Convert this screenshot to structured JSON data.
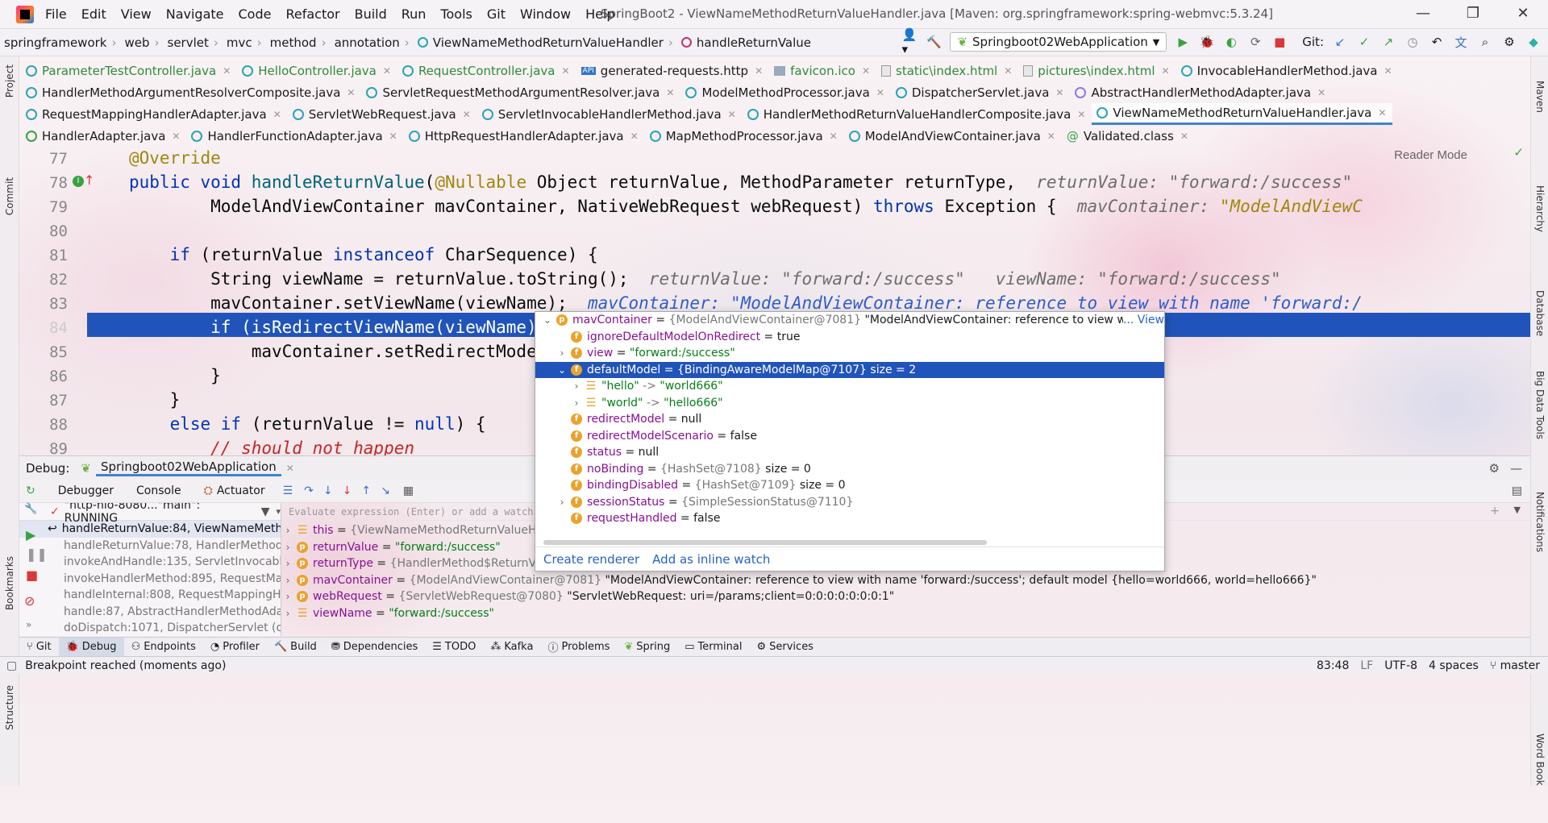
{
  "window": {
    "title": "SpringBoot2 - ViewNameMethodReturnValueHandler.java [Maven: org.springframework:spring-webmvc:5.3.24]",
    "menu": [
      "File",
      "Edit",
      "View",
      "Navigate",
      "Code",
      "Refactor",
      "Build",
      "Run",
      "Tools",
      "Git",
      "Window",
      "Help"
    ]
  },
  "breadcrumb": [
    "springframework",
    "web",
    "servlet",
    "mvc",
    "method",
    "annotation",
    "ViewNameMethodReturnValueHandler",
    "handleReturnValue"
  ],
  "toolbar": {
    "run_config": "Springboot02WebApplication",
    "git_label": "Git:"
  },
  "tabs_row1": [
    {
      "label": "ParameterTestController.java"
    },
    {
      "label": "HelloController.java"
    },
    {
      "label": "RequestController.java"
    },
    {
      "label": "generated-requests.http"
    },
    {
      "label": "favicon.ico"
    },
    {
      "label": "static\\index.html"
    },
    {
      "label": "pictures\\index.html"
    },
    {
      "label": "InvocableHandlerMethod.java"
    }
  ],
  "tabs_row2": [
    {
      "label": "HandlerMethodArgumentResolverComposite.java"
    },
    {
      "label": "ServletRequestMethodArgumentResolver.java"
    },
    {
      "label": "ModelMethodProcessor.java"
    },
    {
      "label": "DispatcherServlet.java"
    },
    {
      "label": "AbstractHandlerMethodAdapter.java"
    }
  ],
  "tabs_row3": [
    {
      "label": "RequestMappingHandlerAdapter.java"
    },
    {
      "label": "ServletWebRequest.java"
    },
    {
      "label": "ServletInvocableHandlerMethod.java"
    },
    {
      "label": "HandlerMethodReturnValueHandlerComposite.java"
    },
    {
      "label": "ViewNameMethodReturnValueHandler.java"
    }
  ],
  "tabs_row4": [
    {
      "label": "HandlerAdapter.java"
    },
    {
      "label": "HandlerFunctionAdapter.java"
    },
    {
      "label": "HttpRequestHandlerAdapter.java"
    },
    {
      "label": "MapMethodProcessor.java"
    },
    {
      "label": "ModelAndViewContainer.java"
    },
    {
      "label": "Validated.class"
    }
  ],
  "editor": {
    "reader_mode": "Reader Mode",
    "lines": [
      {
        "n": "77"
      },
      {
        "n": "78"
      },
      {
        "n": "79"
      },
      {
        "n": "80"
      },
      {
        "n": "81"
      },
      {
        "n": "82"
      },
      {
        "n": "83"
      },
      {
        "n": "84"
      },
      {
        "n": "85"
      },
      {
        "n": "86"
      },
      {
        "n": "87"
      },
      {
        "n": "88"
      },
      {
        "n": "89"
      }
    ],
    "text": {
      "l77": "@Override",
      "l78a": "public void ",
      "l78b": "handleReturnValue",
      "l78c": "(",
      "l78d": "@Nullable",
      "l78e": " Object returnValue, MethodParameter returnType,  ",
      "l78h": "returnValue: \"forward:/success\"",
      "l79a": "        ModelAndViewContainer mavContainer, NativeWebRequest webRequest) ",
      "l79b": "throws",
      "l79c": " Exception {  ",
      "l79h1": "mavContainer: ",
      "l79h2": "\"ModelAndViewC",
      "l81a": "    ",
      "l81b": "if",
      "l81c": " (returnValue ",
      "l81d": "instanceof",
      "l81e": " CharSequence) {",
      "l82a": "        String viewName = returnValue.toString();  ",
      "l82h": "returnValue: \"forward:/success\"   viewName: \"forward:/success\"",
      "l83a": "        mavContainer.setViewName(viewName);  ",
      "l83h": "mavContainer: \"ModelAndViewContainer: reference to view with name 'forward:/",
      "l84": "        if (isRedirectViewName(viewName)) {",
      "l85": "            mavContainer.setRedirectModelSce",
      "l86": "        }",
      "l87": "    }",
      "l88a": "    ",
      "l88b": "else if",
      "l88c": " (returnValue != ",
      "l88d": "null",
      "l88e": ") {",
      "l89": "        // should not happen"
    }
  },
  "debug": {
    "label": "Debug:",
    "session": "Springboot02WebApplication",
    "tabs": [
      "Debugger",
      "Console",
      "Actuator"
    ],
    "thread": "\"http-nio-8080...\"main\": RUNNING",
    "eval_placeholder": "Evaluate expression (Enter) or add a watch (Ctr",
    "frames": [
      "handleReturnValue:84, ViewNameMethodRet",
      "handleReturnValue:78, HandlerMethodRetur",
      "invokeAndHandle:135, ServletInvocableHand",
      "invokeHandlerMethod:895, RequestMapping",
      "handleInternal:808, RequestMappingHandlerA",
      "handle:87, AbstractHandlerMethodAdapter (o",
      "doDispatch:1071, DispatcherServlet (org.sprir"
    ],
    "vars": [
      {
        "name": "this",
        "type": "{ViewNameMethodReturnValueHandle",
        "val": ""
      },
      {
        "name": "returnValue",
        "type": "",
        "val": "\"forward:/success\""
      },
      {
        "name": "returnType",
        "type": "{HandlerMethod$ReturnValueM",
        "val": ""
      },
      {
        "name": "mavContainer",
        "type": "{ModelAndViewContainer@7081}",
        "val": "\"ModelAndViewContainer: reference to view with name 'forward:/success'; default model {hello=world666, world=hello666}\""
      },
      {
        "name": "webRequest",
        "type": "{ServletWebRequest@7080}",
        "val": "\"ServletWebRequest: uri=/params;client=0:0:0:0:0:0:0:1\""
      },
      {
        "name": "viewName",
        "type": "",
        "val": "\"forward:/success\""
      }
    ]
  },
  "popup": {
    "root": {
      "name": "mavContainer",
      "type": "{ModelAndViewContainer@7081}",
      "val": "\"ModelAndViewContainer: reference to view with name 'forward:/",
      "link": "... View"
    },
    "rows": [
      {
        "name": "ignoreDefaultModelOnRedirect",
        "type": "",
        "val": "true"
      },
      {
        "name": "view",
        "type": "",
        "val": "\"forward:/success\""
      },
      {
        "name": "defaultModel",
        "type": "{BindingAwareModelMap@7107}",
        "val": "size = 2"
      },
      {
        "name": "\"hello\"",
        "type": "",
        "val": "\"world666\""
      },
      {
        "name": "\"world\"",
        "type": "",
        "val": "\"hello666\""
      },
      {
        "name": "redirectModel",
        "type": "",
        "val": "null"
      },
      {
        "name": "redirectModelScenario",
        "type": "",
        "val": "false"
      },
      {
        "name": "status",
        "type": "",
        "val": "null"
      },
      {
        "name": "noBinding",
        "type": "{HashSet@7108}",
        "val": "size = 0"
      },
      {
        "name": "bindingDisabled",
        "type": "{HashSet@7109}",
        "val": "size = 0"
      },
      {
        "name": "sessionStatus",
        "type": "{SimpleSessionStatus@7110}",
        "val": ""
      },
      {
        "name": "requestHandled",
        "type": "",
        "val": "false"
      }
    ],
    "create_renderer": "Create renderer",
    "add_inline_watch": "Add as inline watch"
  },
  "toolwindows": [
    "Git",
    "Debug",
    "Endpoints",
    "Profiler",
    "Build",
    "Dependencies",
    "TODO",
    "Kafka",
    "Problems",
    "Spring",
    "Terminal",
    "Services"
  ],
  "status": {
    "message": "Breakpoint reached (moments ago)",
    "position": "83:48",
    "line_sep": "LF",
    "encoding": "UTF-8",
    "indent": "4 spaces",
    "branch": "master"
  },
  "side_left": [
    "Project",
    "Commit",
    "Bookmarks",
    "Structure"
  ],
  "side_right": [
    "Maven",
    "Hierarchy",
    "Database",
    "Big Data Tools",
    "Notifications",
    "Word Book"
  ]
}
